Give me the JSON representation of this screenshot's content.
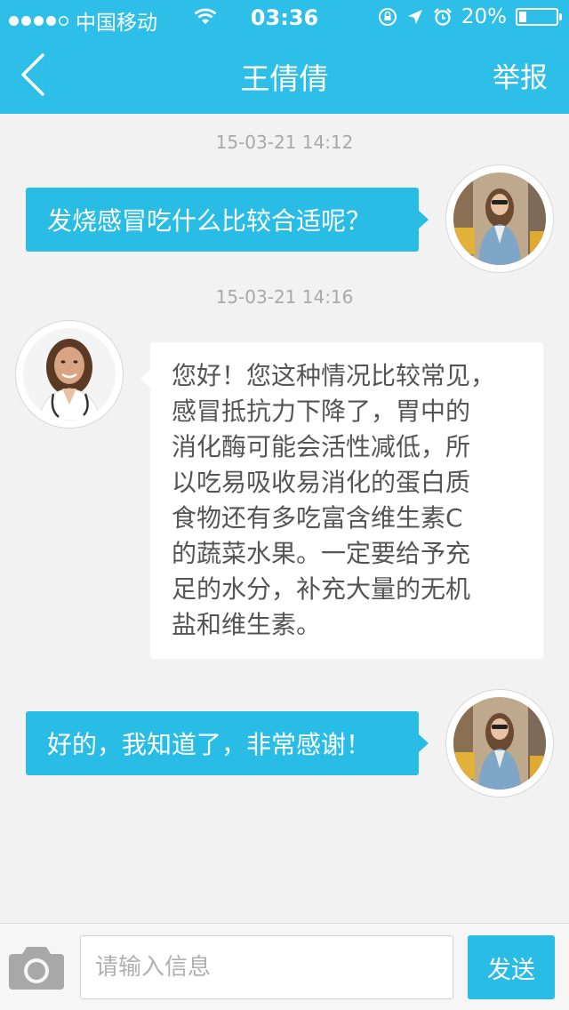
{
  "status_bar": {
    "carrier": "中国移动",
    "time": "03:36",
    "battery": "20%",
    "battery_level": 0.2,
    "signal_bars": 4,
    "icons": [
      "wifi-icon",
      "rotation-lock-icon",
      "location-arrow-icon",
      "alarm-clock-icon"
    ]
  },
  "nav": {
    "back_icon": "chevron-left-icon",
    "title": "王倩倩",
    "report_label": "举报"
  },
  "messages": [
    {
      "timestamp": "15-03-21 14:12",
      "sender": "user",
      "text": "发烧感冒吃什么比较合适呢？",
      "lines": [
        "发烧感冒吃什么比较合适呢？"
      ]
    },
    {
      "timestamp": "15-03-21 14:16",
      "sender": "doctor",
      "text": "您好！您这种情况比较常见，感冒抵抗力下降了，胃中的消化酶可能会活性减低，所以吃易吸收易消化的蛋白质食物还有多吃富含维生素C的蔬菜水果。一定要给予充足的水分，补充大量的无机盐和维生素。",
      "lines": [
        "您好！您这种情况比较常见，",
        "感冒抵抗力下降了，胃中的",
        "消化酶可能会活性减低，所",
        "以吃易吸收易消化的蛋白质",
        "食物还有多吃富含维生素C",
        "的蔬菜水果。一定要给予充",
        "足的水分，补充大量的无机",
        "盐和维生素。"
      ]
    },
    {
      "timestamp": "",
      "sender": "user",
      "text": "好的，我知道了，非常感谢！",
      "lines": [
        "好的，我知道了，非常感谢！"
      ]
    }
  ],
  "input_bar": {
    "camera_icon": "camera-icon",
    "placeholder": "请输入信息",
    "value": "",
    "send_label": "发送"
  },
  "colors": {
    "accent": "#2dbfe8",
    "bubble_out": "#29bde6",
    "background": "#f2f2f2",
    "timestamp_text": "#a9a9a9"
  }
}
